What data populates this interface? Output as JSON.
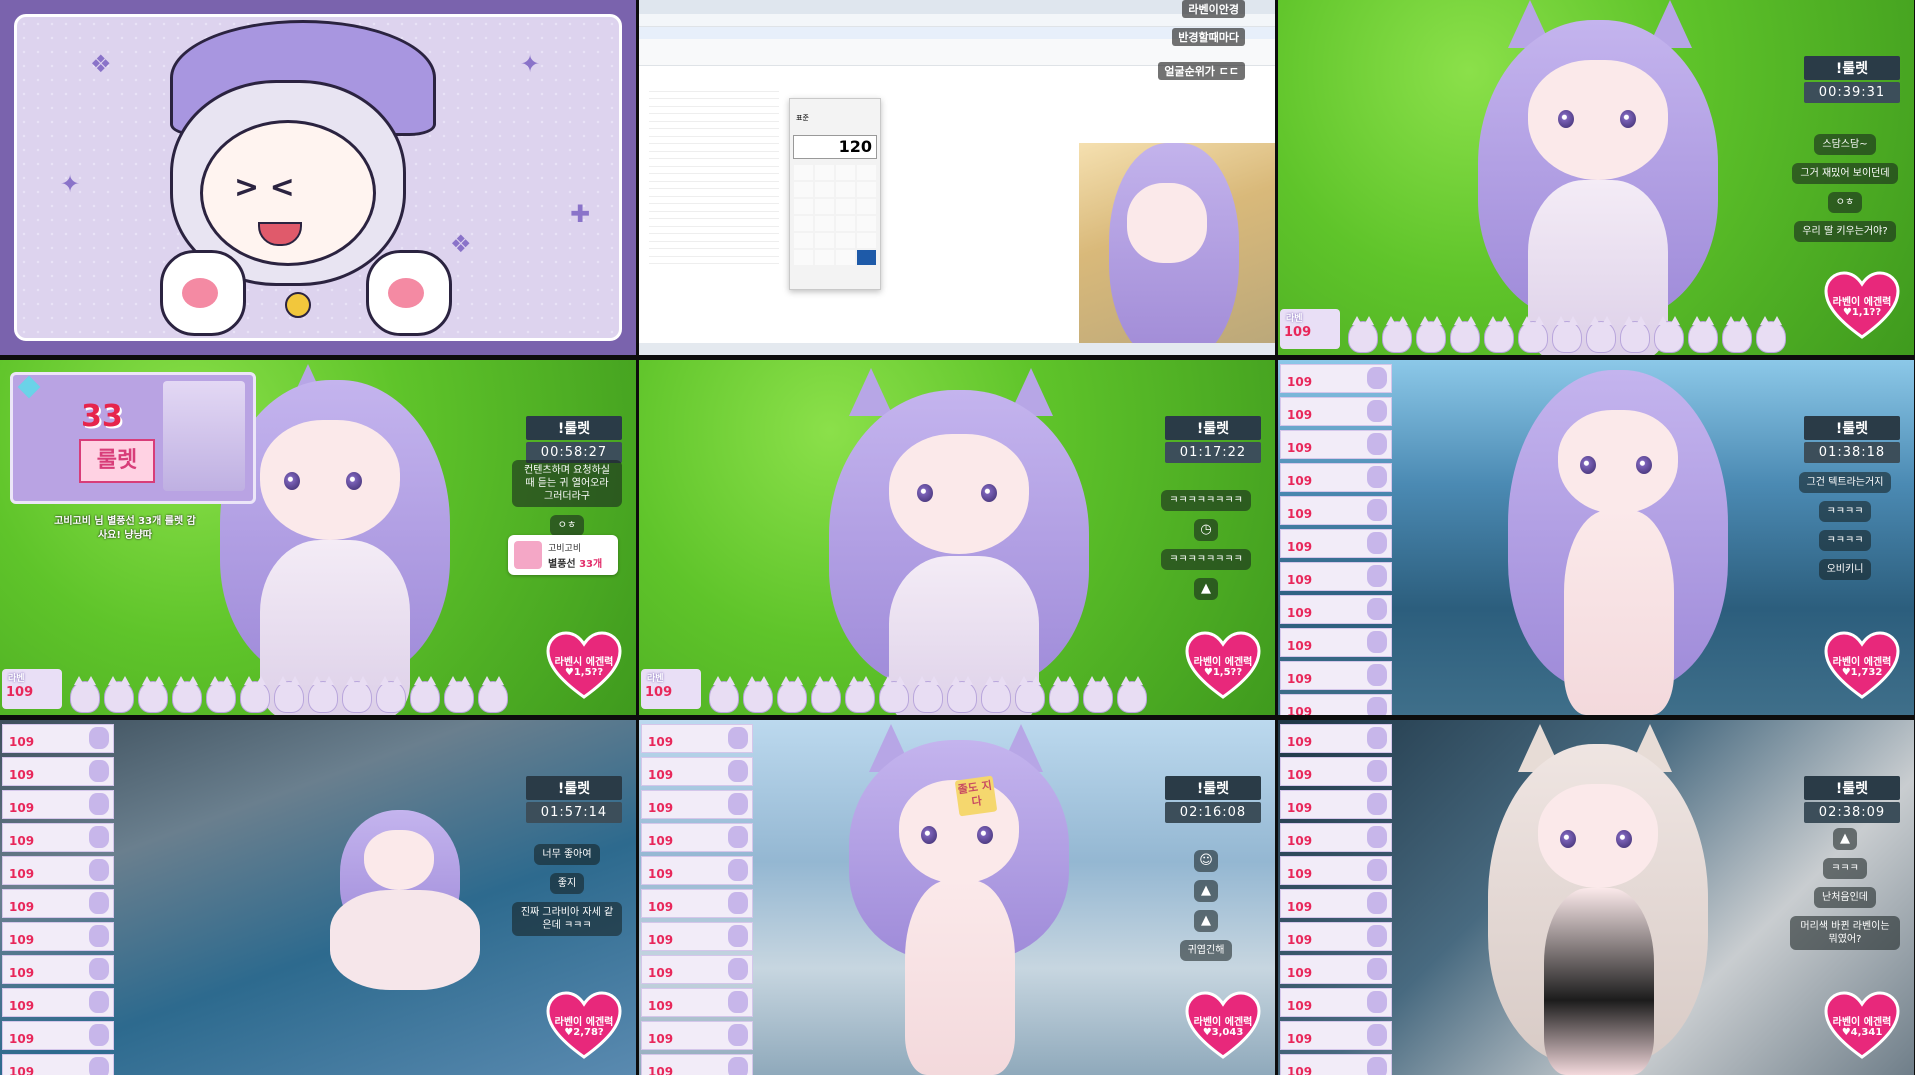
{
  "tiles": {
    "t2": {
      "calc_display": "120",
      "calc_mode": "표준",
      "overlay_top": "라벤이안경",
      "overlay_mid": "반경할때마다",
      "overlay_bot": "얼굴순위가 ㄷㄷ"
    },
    "t3": {
      "roulette_title": "!룰렛",
      "roulette_time": "00:39:31",
      "chat": [
        "스담스담~",
        "그거 재밌어 보이던데",
        "ㅇㅎ",
        "우리 딸 키우는거야?"
      ],
      "heart_title": "라벤이 에겐력",
      "heart_value": "♥1,1??",
      "badge_name": "라벤",
      "badge_num": "109"
    },
    "t4": {
      "roulette_title": "!룰렛",
      "roulette_time": "00:58:27",
      "roulette_count": "33",
      "roulette_label": "룰렛",
      "notice": "고비고비 님 별풍선 33개 룰렛 감사요! 냥냥따",
      "chat": [
        "컨텐츠하며 요청하실때 듣는 귀 열어오라 그러더라구",
        "ㅇㅎ"
      ],
      "gift_name": "고비고비",
      "gift_text": "별풍선",
      "gift_count": "33개",
      "heart_title": "라벤시 에겐력",
      "heart_value": "♥1,5??",
      "badge_name": "라벤",
      "badge_num": "109"
    },
    "t5": {
      "roulette_title": "!룰렛",
      "roulette_time": "01:17:22",
      "chat": [
        "ㅋㅋㅋㅋㅋㅋㅋㅋ",
        "ㅋㅋㅋㅋㅋㅋㅋㅋ"
      ],
      "heart_title": "라벤이 에겐력",
      "heart_value": "♥1,5??",
      "badge_name": "라벤",
      "badge_num": "109"
    },
    "t6": {
      "roulette_title": "!룰렛",
      "roulette_time": "01:38:18",
      "chat": [
        "그건 텍트라는거지",
        "ㅋㅋㅋㅋ",
        "ㅋㅋㅋㅋ",
        "오비키니"
      ],
      "heart_title": "라벤이 에겐력",
      "heart_value": "♥1,732",
      "card_num": "109"
    },
    "t7": {
      "roulette_title": "!룰렛",
      "roulette_time": "01:57:14",
      "chat": [
        "너무 좋아여",
        "좋지",
        "진짜 그라비아 자세 같은데 ㅋㅋㅋ"
      ],
      "heart_title": "라벤이 에겐력",
      "heart_value": "♥2,78?",
      "card_num": "109"
    },
    "t8": {
      "roulette_title": "!룰렛",
      "roulette_time": "02:16:08",
      "chat": [
        "귀엽긴해"
      ],
      "heart_title": "라벤이 에겐력",
      "heart_value": "♥3,043",
      "sticky": "졸도 지다",
      "card_num": "109"
    },
    "t9": {
      "roulette_title": "!룰렛",
      "roulette_time": "02:38:09",
      "chat": [
        "ㅋㅋㅋ",
        "난처음인데",
        "머리색 바뀐 라벤이는 뭐였어?"
      ],
      "heart_title": "라벤이 에겐력",
      "heart_value": "♥4,341",
      "card_num": "109"
    }
  },
  "colors": {
    "heart": "#e8287b",
    "roulette_bg": "#2a3b47",
    "hair": "#b7a6e6"
  }
}
